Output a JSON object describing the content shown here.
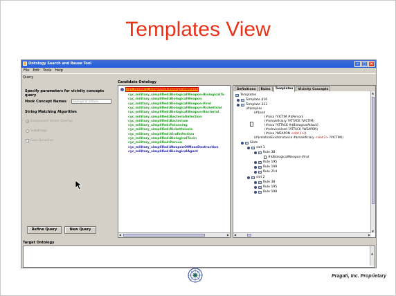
{
  "slide": {
    "title": "Templates View",
    "footer": "Pragati, Inc. Proprietary"
  },
  "window": {
    "title": "Ontology Search and Reuse Tool"
  },
  "menu": [
    "File",
    "Edit",
    "Tools",
    "Help"
  ],
  "query": {
    "section_label": "Query",
    "params_label": "Specify parameters for vicinity concepts query",
    "hook_label": "Hook Concept Names",
    "hook_value": "biological attack",
    "matching_label": "String Matching Algorithm",
    "options": [
      "Component Vector Overlap",
      "Substrings",
      "Case Sensitive"
    ],
    "refine_button": "Refine Query",
    "new_button": "New Query"
  },
  "candidate": {
    "label": "Candidate Ontology",
    "root": "cyc_military_simplified:BiologicalAttack",
    "items": [
      {
        "text": "cyc_military_simplified:BiologicalWeapon-BiologicalTo",
        "color": "#1a9c1a"
      },
      {
        "text": "cyc_military_simplified:BiologicalWeapon",
        "color": "#1a9c1a"
      },
      {
        "text": "cyc_military_simplified:BiologicalWeapon-Viral",
        "color": "#1a9c1a"
      },
      {
        "text": "cyc_military_simplified:BiologicalWeapon-Rickettsial",
        "color": "#1a9c1a"
      },
      {
        "text": "cyc_military_simplified:BiologicalWeapon-Bacterial",
        "color": "#1a9c1a"
      },
      {
        "text": "cyc_military_simplified:BacterialInfection",
        "color": "#1a9c1a"
      },
      {
        "text": "cyc_military_simplified:Bacterium",
        "color": "#1a9c1a"
      },
      {
        "text": "cyc_military_simplified:Poisoning",
        "color": "#1a9c1a"
      },
      {
        "text": "cyc_military_simplified:Rickettsiosis",
        "color": "#1a9c1a"
      },
      {
        "text": "cyc_military_simplified:ViralInfection",
        "color": "#1a9c1a"
      },
      {
        "text": "cyc_military_simplified:BiologicalToxin",
        "color": "#1a9c1a"
      },
      {
        "text": "cyc_military_simplified:Person",
        "color": "#1a9c1a"
      },
      {
        "text": "cyc_military_simplified:WeaponOfMassDestruction",
        "color": "#1a1ab0"
      },
      {
        "text": "cyc_military_simplified:BiologicalAgent",
        "color": "#1a1ab0"
      }
    ]
  },
  "tabs": [
    {
      "label": "Definitions",
      "active": false
    },
    {
      "label": "Rules",
      "active": false
    },
    {
      "label": "Templates",
      "active": true
    },
    {
      "label": "Vicinity Concepts",
      "active": false
    }
  ],
  "tree": {
    "root": "Templates",
    "template416": "Template 416",
    "template323": "Template 323",
    "implies": "(#$implies",
    "and": "(#$and",
    "code": [
      "(#$isa ?VICTIM #$Person)",
      "(#$maleficiary ?ATTACK ?VICTIM)",
      "(#$isa ?ATTACK #$BiologicalAttack)",
      "(#$deviceUsed ?ATTACK ?WEAPON)",
      "(#$isa ?WEAPON "
    ],
    "slot_inline": "<slot 1>",
    "last_pre": "(#$relationExistsInstance #$maleficiary ",
    "last_slot": "<slot 2>",
    "last_post": " ?VICTIM))",
    "slots": "Slots",
    "slot1": "slot 1",
    "rule38": "Rule 38",
    "bio_viral": "#$BiologicalWeapon-Viral",
    "rule195": "Rule 195",
    "rule199": "Rule 199",
    "rule214": "Rule 214",
    "slot2": "slot 2",
    "s2_rule38": "Rule 38",
    "s2_rule195": "Rule 195",
    "s2_rule199": "Rule 199"
  },
  "target": {
    "label": "Target Ontology"
  }
}
